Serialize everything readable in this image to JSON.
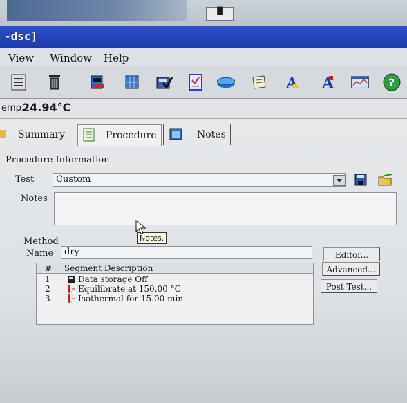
{
  "window": {
    "title": "-dsc]"
  },
  "desktop": {
    "tray_label": "▐▌"
  },
  "menu": {
    "items": [
      "View",
      "Window",
      "Help"
    ]
  },
  "toolbar": {
    "buttons": [
      "list-icon",
      "trash-icon",
      "instrument-icon",
      "grid-icon",
      "check-save-icon",
      "checklist-icon",
      "pan-icon",
      "scroll-icon",
      "font-a-icon",
      "font-a-red-icon",
      "chart-window-icon",
      "help-icon"
    ]
  },
  "status": {
    "temp_label": "emp:",
    "temp_value": "24.94°C"
  },
  "tabs": [
    {
      "label": "Summary",
      "icon": "summary-icon"
    },
    {
      "label": "Procedure",
      "icon": "procedure-icon",
      "active": true
    },
    {
      "label": "Notes",
      "icon": "notes-icon"
    }
  ],
  "procedure": {
    "section_title": "Procedure Information",
    "test_label": "Test",
    "test_value": "Custom",
    "notes_label": "Notes",
    "notes_value": "",
    "tooltip": "Notes."
  },
  "method": {
    "section_title": "Method",
    "name_label": "Name",
    "name_value": "dry",
    "buttons": {
      "editor": "Editor...",
      "advanced": "Advanced...",
      "post_test": "Post Test..."
    },
    "table": {
      "headers": [
        "#",
        "Segment Description"
      ],
      "rows": [
        {
          "num": "1",
          "icon": "save-disk-icon",
          "desc": "Data storage Off"
        },
        {
          "num": "2",
          "icon": "thermometer-icon",
          "desc": "Equilibrate at 150.00 °C"
        },
        {
          "num": "3",
          "icon": "thermometer-icon",
          "desc": "Isothermal for 15.00 min"
        }
      ]
    }
  }
}
